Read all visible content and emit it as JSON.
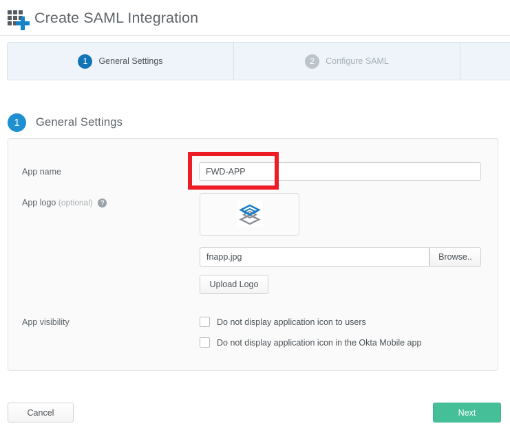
{
  "header": {
    "title": "Create SAML Integration",
    "icon": "app-add-icon"
  },
  "stepper": {
    "steps": [
      {
        "number": "1",
        "label": "General Settings",
        "state": "active"
      },
      {
        "number": "2",
        "label": "Configure SAML",
        "state": "inactive"
      },
      {
        "number": "",
        "label": "",
        "state": "empty"
      }
    ]
  },
  "section": {
    "number": "1",
    "title": "General Settings"
  },
  "form": {
    "app_name": {
      "label": "App name",
      "value": "FWD-APP",
      "placeholder": ""
    },
    "app_logo": {
      "label": "App logo",
      "optional": "(optional)",
      "help_icon": "question-mark-icon",
      "preview_icon": "layers-logo-icon",
      "file_name": "fnapp.jpg",
      "browse_label": "Browse..",
      "upload_label": "Upload Logo"
    },
    "app_visibility": {
      "label": "App visibility",
      "options": [
        {
          "label": "Do not display application icon to users",
          "checked": false
        },
        {
          "label": "Do not display application icon in the Okta Mobile app",
          "checked": false
        }
      ]
    }
  },
  "footer": {
    "cancel_label": "Cancel",
    "next_label": "Next"
  },
  "annotation": {
    "highlight_color": "#ee1c25",
    "target": "app-name-input"
  },
  "colors": {
    "accent_blue": "#1274b5",
    "section_blue": "#1e8fd0",
    "primary_green": "#44bf97",
    "tab_background": "#eef4fa",
    "panel_background": "#fafafa",
    "inactive_gray": "#bcc3ca"
  }
}
